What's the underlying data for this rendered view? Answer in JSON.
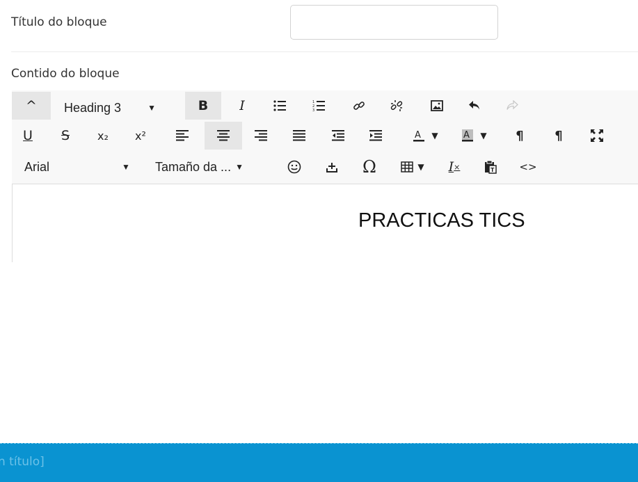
{
  "form": {
    "title_label": "Título do bloque",
    "title_value": "",
    "content_label": "Contido do bloque"
  },
  "toolbar": {
    "row1": {
      "collapse_icon": "^",
      "format_value": "Heading 3",
      "bold": "B",
      "italic": "I"
    },
    "row2": {
      "underline": "U",
      "strikethrough": "S",
      "subscript": "x₂",
      "superscript": "x²",
      "ltr": "¶",
      "rtl": "¶"
    },
    "row3": {
      "font_family_value": "Arial",
      "font_size_value": "Tamaño da ...",
      "special_char": "Ω",
      "clear_format": "I",
      "code": "<>"
    }
  },
  "editor": {
    "content": "PRACTICAS TICS"
  },
  "footer": {
    "text": "n título]"
  },
  "colors": {
    "footer_bg": "#0a93d1",
    "toolbar_bg": "#f8f8f8",
    "active_button_bg": "#e6e6e6"
  }
}
